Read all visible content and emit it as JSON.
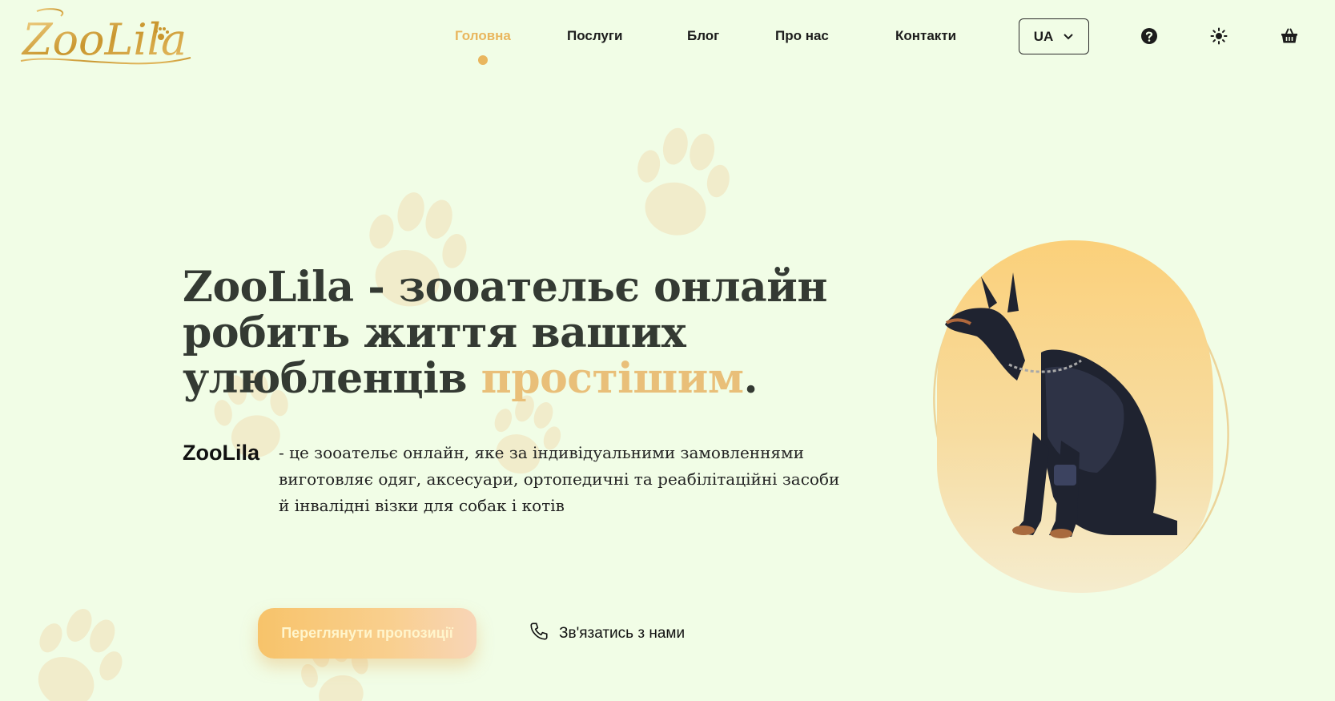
{
  "header": {
    "logo_text": "ZooLila",
    "nav": [
      {
        "label": "Головна",
        "active": true
      },
      {
        "label": "Послуги",
        "active": false
      },
      {
        "label": "Блог",
        "active": false
      },
      {
        "label": "Про нас",
        "active": false
      },
      {
        "label": "Контакти",
        "active": false
      }
    ],
    "language": "UA",
    "icons": [
      "help-icon",
      "theme-toggle-icon",
      "cart-icon"
    ]
  },
  "hero": {
    "title_main": "ZooLila - зооательє онлайн робить життя ваших улюбленців ",
    "title_accent": "простішим",
    "title_end": ".",
    "brand_lead": "ZooLila",
    "description": "- це зооательє онлайн, яке за індивідуальними замовленнями виготовляє одяг, аксесуари, ортопедичні та реабілітаційні засоби й інвалідні візки для собак і котів",
    "cta_primary": "Переглянути пропозиції",
    "cta_secondary": "Зв'язатись з нами"
  },
  "colors": {
    "background": "#f1fde6",
    "accent": "#e9b65e",
    "paw": "#f1eccb",
    "text_dark": "#343a33"
  }
}
